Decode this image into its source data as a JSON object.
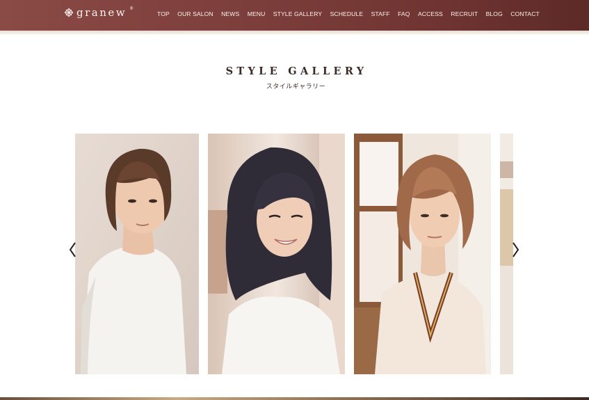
{
  "header": {
    "logo_text": "granew",
    "logo_sup": "®",
    "nav": [
      "TOP",
      "OUR SALON",
      "NEWS",
      "MENU",
      "STYLE GALLERY",
      "SCHEDULE",
      "STAFF",
      "FAQ",
      "ACCESS",
      "RECRUIT",
      "BLOG",
      "CONTACT"
    ]
  },
  "section": {
    "title": "STYLE GALLERY",
    "subtitle": "スタイルギャラリー"
  },
  "gallery": {
    "arrow_prev": "‹",
    "arrow_next": "›",
    "photos": [
      {
        "icon": "photo-bob-brown"
      },
      {
        "icon": "photo-long-dark"
      },
      {
        "icon": "photo-bob-light"
      },
      {
        "icon": "photo-partial"
      }
    ]
  },
  "colors": {
    "header": "#7d3f3c",
    "text_dark": "#3b2b27"
  }
}
